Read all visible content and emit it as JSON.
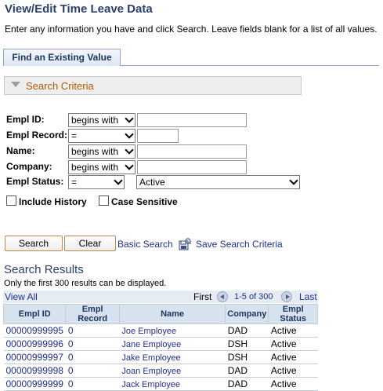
{
  "page": {
    "title": "View/Edit Time Leave Data",
    "instructions": "Enter any information you have and click Search. Leave fields blank for a list of all values."
  },
  "tabs": [
    {
      "label": "Find an Existing Value"
    }
  ],
  "search_criteria": {
    "header": "Search Criteria",
    "fields": [
      {
        "label": "Empl ID:",
        "operator": "begins with",
        "value": ""
      },
      {
        "label": "Empl Record:",
        "operator": "=",
        "value": ""
      },
      {
        "label": "Name:",
        "operator": "begins with",
        "value": ""
      },
      {
        "label": "Company:",
        "operator": "begins with",
        "value": ""
      },
      {
        "label": "Empl Status:",
        "operator": "=",
        "value": "Active"
      }
    ],
    "include_history": {
      "label": "Include History",
      "checked": false
    },
    "case_sensitive": {
      "label": "Case Sensitive",
      "checked": false
    }
  },
  "actions": {
    "search": "Search",
    "clear": "Clear",
    "basic_search": "Basic Search",
    "save_search": "Save Search Criteria"
  },
  "results": {
    "title": "Search Results",
    "note": "Only the first 300 results can be displayed.",
    "view_all": "View All",
    "first": "First",
    "range": "1-5 of 300",
    "last": "Last",
    "columns": [
      "Empl ID",
      "Empl Record",
      "Name",
      "Company",
      "Empl Status"
    ],
    "rows": [
      {
        "empl_id": "00000999995",
        "empl_record": "0",
        "name": "Joe Employee",
        "company": "DAD",
        "status": "Active"
      },
      {
        "empl_id": "00000999996",
        "empl_record": "0",
        "name": "Jane Employee",
        "company": "DSH",
        "status": "Active"
      },
      {
        "empl_id": "00000999997",
        "empl_record": "0",
        "name": "Jake Employee",
        "company": "DSH",
        "status": "Active"
      },
      {
        "empl_id": "00000999998",
        "empl_record": "0",
        "name": "Joan Employee",
        "company": "DAD",
        "status": "Active"
      },
      {
        "empl_id": "00000999999",
        "empl_record": "0",
        "name": "Jack Employee",
        "company": "DAD",
        "status": "Active"
      }
    ]
  },
  "icons": {
    "save_search": "save-criteria-icon",
    "collapse": "collapse-triangle-icon"
  }
}
